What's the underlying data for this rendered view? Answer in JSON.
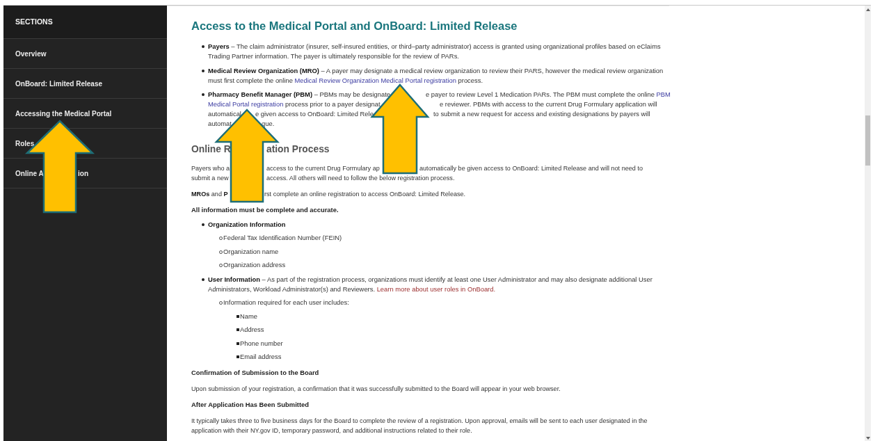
{
  "sidebar": {
    "title": "SECTIONS",
    "items": [
      {
        "label": [
          "Overview"
        ]
      },
      {
        "label": [
          "OnBoard: Limited Release"
        ]
      },
      {
        "label": [
          "Accessing the Medical Portal"
        ]
      },
      {
        "label": [
          "Roles"
        ]
      },
      {
        "label": [
          "Online A",
          "ion"
        ]
      }
    ]
  },
  "content": {
    "blocks": [
      {
        "kind": "title",
        "lines": [
          [
            [
              {
                "kind": "text",
                "text": "Access to the Medical Portal and OnBoard: Limited Release"
              }
            ]
          ]
        ]
      },
      {
        "kind": "bullet",
        "lines": [
          [
            [
              {
                "kind": "bold",
                "text": "Payers"
              },
              {
                "kind": "text",
                "text": " – The claim administrator (insurer, self-insured entities, or third–party administrator) access is granted using organizational profiles based on eClaims"
              }
            ]
          ],
          [
            [
              {
                "kind": "text",
                "text": "Trading Partner information. The payer is ultimately responsible for the review of PARs."
              }
            ]
          ]
        ]
      },
      {
        "kind": "bullet",
        "lines": [
          [
            [
              {
                "kind": "bold",
                "text": "Medical Review Organization (MRO)"
              },
              {
                "kind": "text",
                "text": " – A payer may designate a medical review organization to review their PARS, however the medical review organization"
              }
            ]
          ],
          [
            [
              {
                "kind": "text",
                "text": "must first complete the online "
              },
              {
                "kind": "link",
                "text": "Medical Review Organization Medical Portal registration"
              },
              {
                "kind": "text",
                "text": " process."
              }
            ]
          ]
        ]
      },
      {
        "kind": "bullet",
        "lines": [
          [
            [
              {
                "kind": "bold",
                "text": "Pharmacy Benefit Manager (PBM)"
              },
              {
                "kind": "text",
                "text": " – PBMs may be designate"
              }
            ],
            [
              {
                "kind": "text",
                "text": "e payer to review Level 1 Medication PARs. The PBM must complete the online "
              },
              {
                "kind": "link",
                "text": "PBM"
              }
            ]
          ],
          [
            [
              {
                "kind": "link",
                "text": "Medical Portal registration"
              },
              {
                "kind": "text",
                "text": " process prior to a payer designat"
              }
            ],
            [
              {
                "kind": "text",
                "text": "e reviewer. PBMs with access to the current Drug Formulary application will"
              }
            ]
          ],
          [
            [
              {
                "kind": "text",
                "text": "automatical"
              }
            ],
            [
              {
                "kind": "text",
                "text": "e given access to OnBoard: Limited Rele"
              }
            ],
            [
              {
                "kind": "text",
                "text": "to submit a new request for access and existing designations by payers will"
              }
            ]
          ],
          [
            [
              {
                "kind": "text",
                "text": "automat"
              }
            ],
            [
              {
                "kind": "text",
                "text": "que."
              }
            ]
          ]
        ]
      },
      {
        "kind": "section-heading",
        "lines": [
          [
            [
              {
                "kind": "text",
                "text": "Online R"
              }
            ],
            [
              {
                "kind": "text",
                "text": "ation Process"
              }
            ]
          ]
        ]
      },
      {
        "kind": "para",
        "lines": [
          [
            [
              {
                "kind": "text",
                "text": "Payers who a"
              }
            ],
            [
              {
                "kind": "text",
                "text": "access to the current Drug Formulary ap"
              }
            ],
            [
              {
                "kind": "text",
                "text": "automatically be given access to OnBoard: Limited Release and will not need to"
              }
            ]
          ],
          [
            [
              {
                "kind": "text",
                "text": "submit a new"
              }
            ],
            [
              {
                "kind": "text",
                "text": "access. All others will need to follow the below registration process."
              }
            ]
          ]
        ]
      },
      {
        "kind": "para",
        "lines": [
          [
            [
              {
                "kind": "bold",
                "text": "MROs"
              },
              {
                "kind": "text",
                "text": " and "
              },
              {
                "kind": "bold",
                "text": "P"
              }
            ],
            [
              {
                "kind": "text",
                "text": "rst complete an online registration to access OnBoard: Limited Release."
              }
            ]
          ]
        ]
      },
      {
        "kind": "subhead",
        "lines": [
          [
            [
              {
                "kind": "text",
                "text": "All information must be complete and accurate."
              }
            ]
          ]
        ]
      },
      {
        "kind": "bullet",
        "lines": [
          [
            [
              {
                "kind": "bold",
                "text": "Organization Information"
              }
            ]
          ]
        ]
      },
      {
        "kind": "subbullet",
        "lines": [
          [
            [
              {
                "kind": "text",
                "text": "Federal Tax Identification Number (FEIN)"
              }
            ]
          ]
        ]
      },
      {
        "kind": "subbullet",
        "lines": [
          [
            [
              {
                "kind": "text",
                "text": "Organization name"
              }
            ]
          ]
        ]
      },
      {
        "kind": "subbullet",
        "lines": [
          [
            [
              {
                "kind": "text",
                "text": "Organization address"
              }
            ]
          ]
        ]
      },
      {
        "kind": "bullet",
        "lines": [
          [
            [
              {
                "kind": "bold",
                "text": "User Information"
              },
              {
                "kind": "text",
                "text": " – As part of the registration process, organizations must identify at least one User Administrator and may also designate additional User"
              }
            ]
          ],
          [
            [
              {
                "kind": "text",
                "text": "Administrators, Workload Administrator(s) and Reviewers. "
              },
              {
                "kind": "related-link",
                "text": "Learn more about user roles in OnBoard."
              }
            ]
          ]
        ]
      },
      {
        "kind": "subbullet",
        "lines": [
          [
            [
              {
                "kind": "text",
                "text": "Information required for each user includes:"
              }
            ]
          ]
        ]
      },
      {
        "kind": "subsubbullet",
        "lines": [
          [
            [
              {
                "kind": "text",
                "text": "Name"
              }
            ]
          ]
        ]
      },
      {
        "kind": "subsubbullet",
        "lines": [
          [
            [
              {
                "kind": "text",
                "text": "Address"
              }
            ]
          ]
        ]
      },
      {
        "kind": "subsubbullet",
        "lines": [
          [
            [
              {
                "kind": "text",
                "text": "Phone number"
              }
            ]
          ]
        ]
      },
      {
        "kind": "subsubbullet",
        "lines": [
          [
            [
              {
                "kind": "text",
                "text": "Email address"
              }
            ]
          ]
        ]
      },
      {
        "kind": "subhead",
        "lines": [
          [
            [
              {
                "kind": "text",
                "text": "Confirmation of Submission to the Board"
              }
            ]
          ]
        ]
      },
      {
        "kind": "para",
        "lines": [
          [
            [
              {
                "kind": "text",
                "text": "Upon submission of your registration, a confirmation that it was successfully submitted to the Board will appear in your web browser."
              }
            ]
          ]
        ]
      },
      {
        "kind": "subhead",
        "lines": [
          [
            [
              {
                "kind": "text",
                "text": "After Application Has Been Submitted"
              }
            ]
          ]
        ]
      },
      {
        "kind": "para",
        "lines": [
          [
            [
              {
                "kind": "text",
                "text": "It typically takes three to five business days for the Board to complete the review of a registration. Upon approval, emails will be sent to each user designated in the"
              }
            ]
          ],
          [
            [
              {
                "kind": "text",
                "text": "application with their NY.gov ID, temporary password, and additional instructions related to their role."
              }
            ]
          ]
        ]
      }
    ]
  }
}
